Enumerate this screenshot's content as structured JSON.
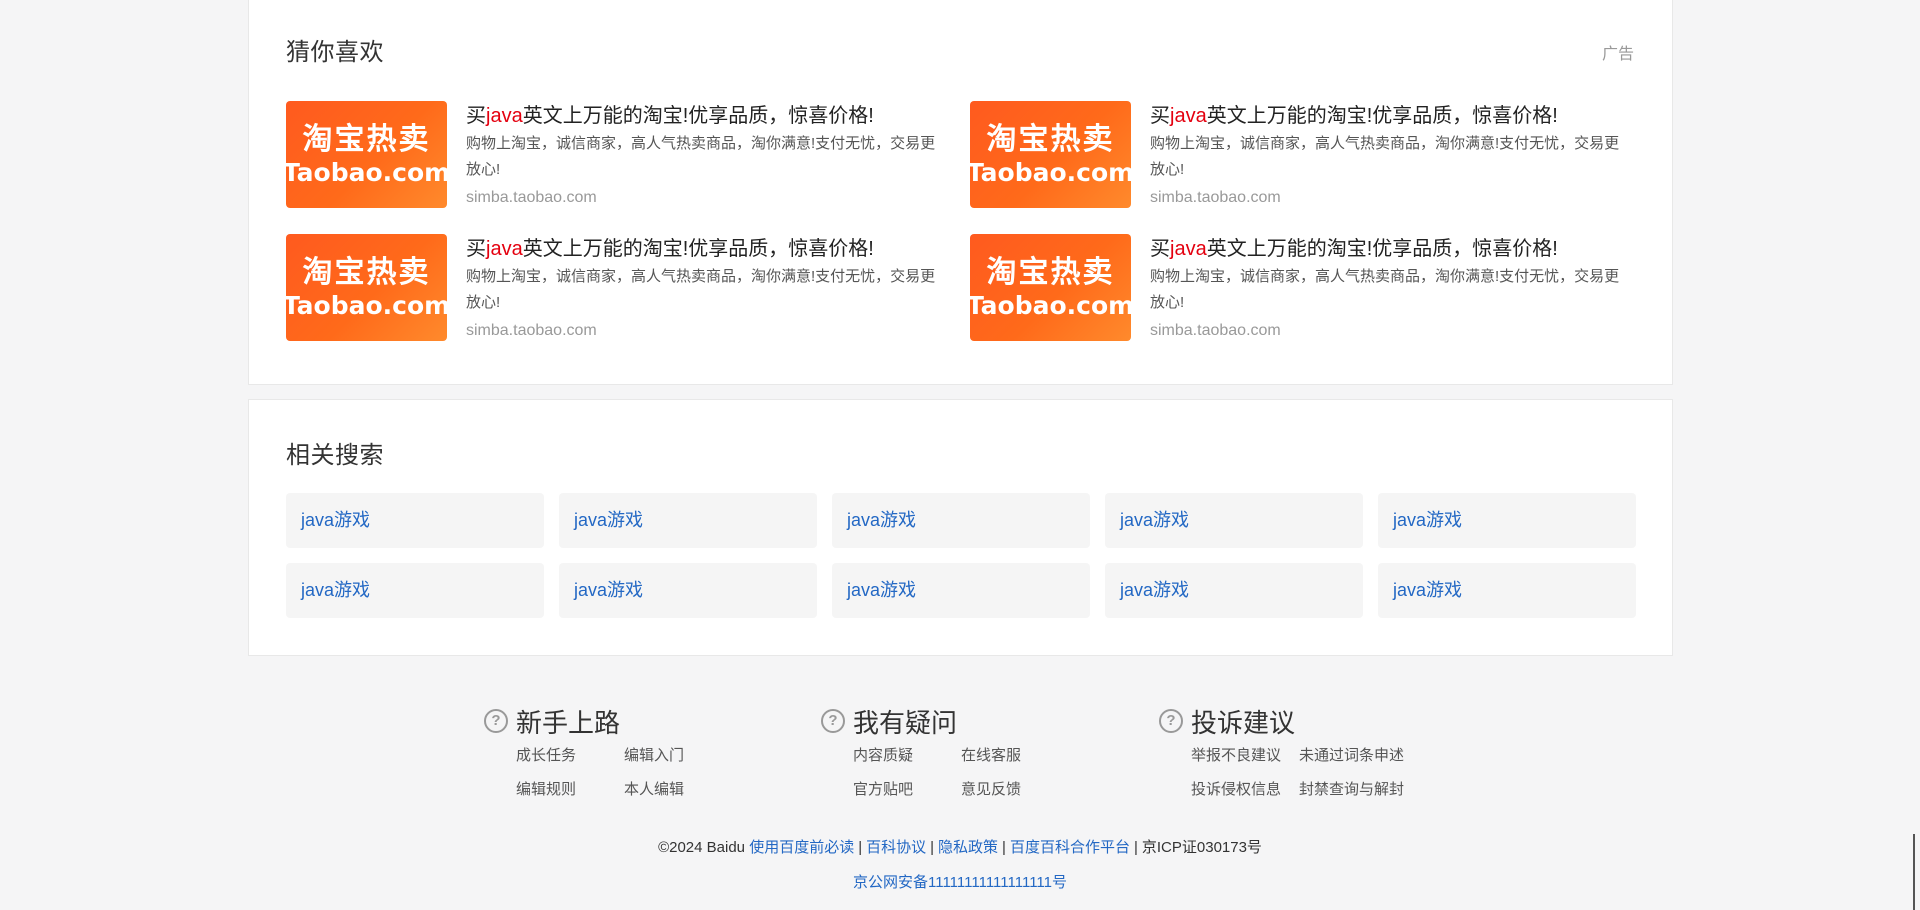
{
  "guess": {
    "title": "猜你喜欢",
    "ad_label": "广告",
    "items": [
      {
        "thumb_cn": "淘宝热卖",
        "thumb_en": "Taobao.com",
        "title_pre": "买",
        "title_hl": "java",
        "title_post": "英文上万能的淘宝!优享品质，惊喜价格!",
        "desc": "购物上淘宝，诚信商家，高人气热卖商品，淘你满意!支付无忧，交易更放心!",
        "url": "simba.taobao.com"
      },
      {
        "thumb_cn": "淘宝热卖",
        "thumb_en": "Taobao.com",
        "title_pre": "买",
        "title_hl": "java",
        "title_post": "英文上万能的淘宝!优享品质，惊喜价格!",
        "desc": "购物上淘宝，诚信商家，高人气热卖商品，淘你满意!支付无忧，交易更放心!",
        "url": "simba.taobao.com"
      },
      {
        "thumb_cn": "淘宝热卖",
        "thumb_en": "Taobao.com",
        "title_pre": "买",
        "title_hl": "java",
        "title_post": "英文上万能的淘宝!优享品质，惊喜价格!",
        "desc": "购物上淘宝，诚信商家，高人气热卖商品，淘你满意!支付无忧，交易更放心!",
        "url": "simba.taobao.com"
      },
      {
        "thumb_cn": "淘宝热卖",
        "thumb_en": "Taobao.com",
        "title_pre": "买",
        "title_hl": "java",
        "title_post": "英文上万能的淘宝!优享品质，惊喜价格!",
        "desc": "购物上淘宝，诚信商家，高人气热卖商品，淘你满意!支付无忧，交易更放心!",
        "url": "simba.taobao.com"
      }
    ]
  },
  "related": {
    "title": "相关搜索",
    "chips": [
      "java游戏",
      "java游戏",
      "java游戏",
      "java游戏",
      "java游戏",
      "java游戏",
      "java游戏",
      "java游戏",
      "java游戏",
      "java游戏"
    ]
  },
  "footer": {
    "icon_glyph": "?",
    "columns": [
      {
        "title": "新手上路",
        "links": [
          "成长任务",
          "编辑入门",
          "编辑规则",
          "本人编辑"
        ]
      },
      {
        "title": "我有疑问",
        "links": [
          "内容质疑",
          "在线客服",
          "官方贴吧",
          "意见反馈"
        ]
      },
      {
        "title": "投诉建议",
        "links": [
          "举报不良建议",
          "未通过词条申述",
          "投诉侵权信息",
          "封禁查询与解封"
        ]
      }
    ],
    "copyright": "©2024 Baidu",
    "links": [
      "使用百度前必读",
      "百科协议",
      "隐私政策",
      "百度百科合作平台"
    ],
    "separator": "|",
    "icp": "京ICP证030173号",
    "beian": "京公网安备11111111111111111号"
  },
  "colors": {
    "link": "#2368c4",
    "highlight": "#e4000f",
    "taobao_orange": "#ff5a1f"
  }
}
